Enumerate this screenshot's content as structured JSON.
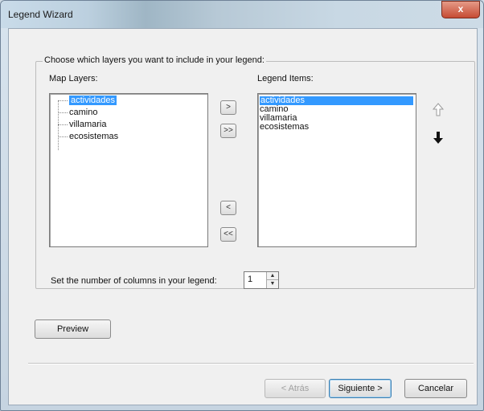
{
  "window": {
    "title": "Legend Wizard",
    "close_label": "x"
  },
  "group": {
    "legend": "Choose which layers you want to include in your legend:"
  },
  "map_layers": {
    "label": "Map Layers:",
    "items": [
      {
        "text": "actividades",
        "selected": true
      },
      {
        "text": "camino",
        "selected": false
      },
      {
        "text": "villamaria",
        "selected": false
      },
      {
        "text": "ecosistemas",
        "selected": false
      }
    ]
  },
  "legend_items": {
    "label": "Legend Items:",
    "items": [
      {
        "text": "actividades",
        "selected": true
      },
      {
        "text": "camino",
        "selected": false
      },
      {
        "text": "villamaria",
        "selected": false
      },
      {
        "text": "ecosistemas",
        "selected": false
      }
    ]
  },
  "transfer": {
    "add_one": ">",
    "add_all": ">>",
    "remove_one": "<",
    "remove_all": "<<"
  },
  "order": {
    "up_icon": "arrow-up-icon",
    "down_icon": "arrow-down-icon"
  },
  "columns": {
    "label": "Set the number of columns in your legend:",
    "value": "1"
  },
  "preview": {
    "label": "Preview"
  },
  "footer": {
    "back_label": "< Atrás",
    "next_label": "Siguiente >",
    "cancel_label": "Cancelar"
  },
  "colors": {
    "selection": "#3399ff",
    "close_button": "#c64b34"
  }
}
